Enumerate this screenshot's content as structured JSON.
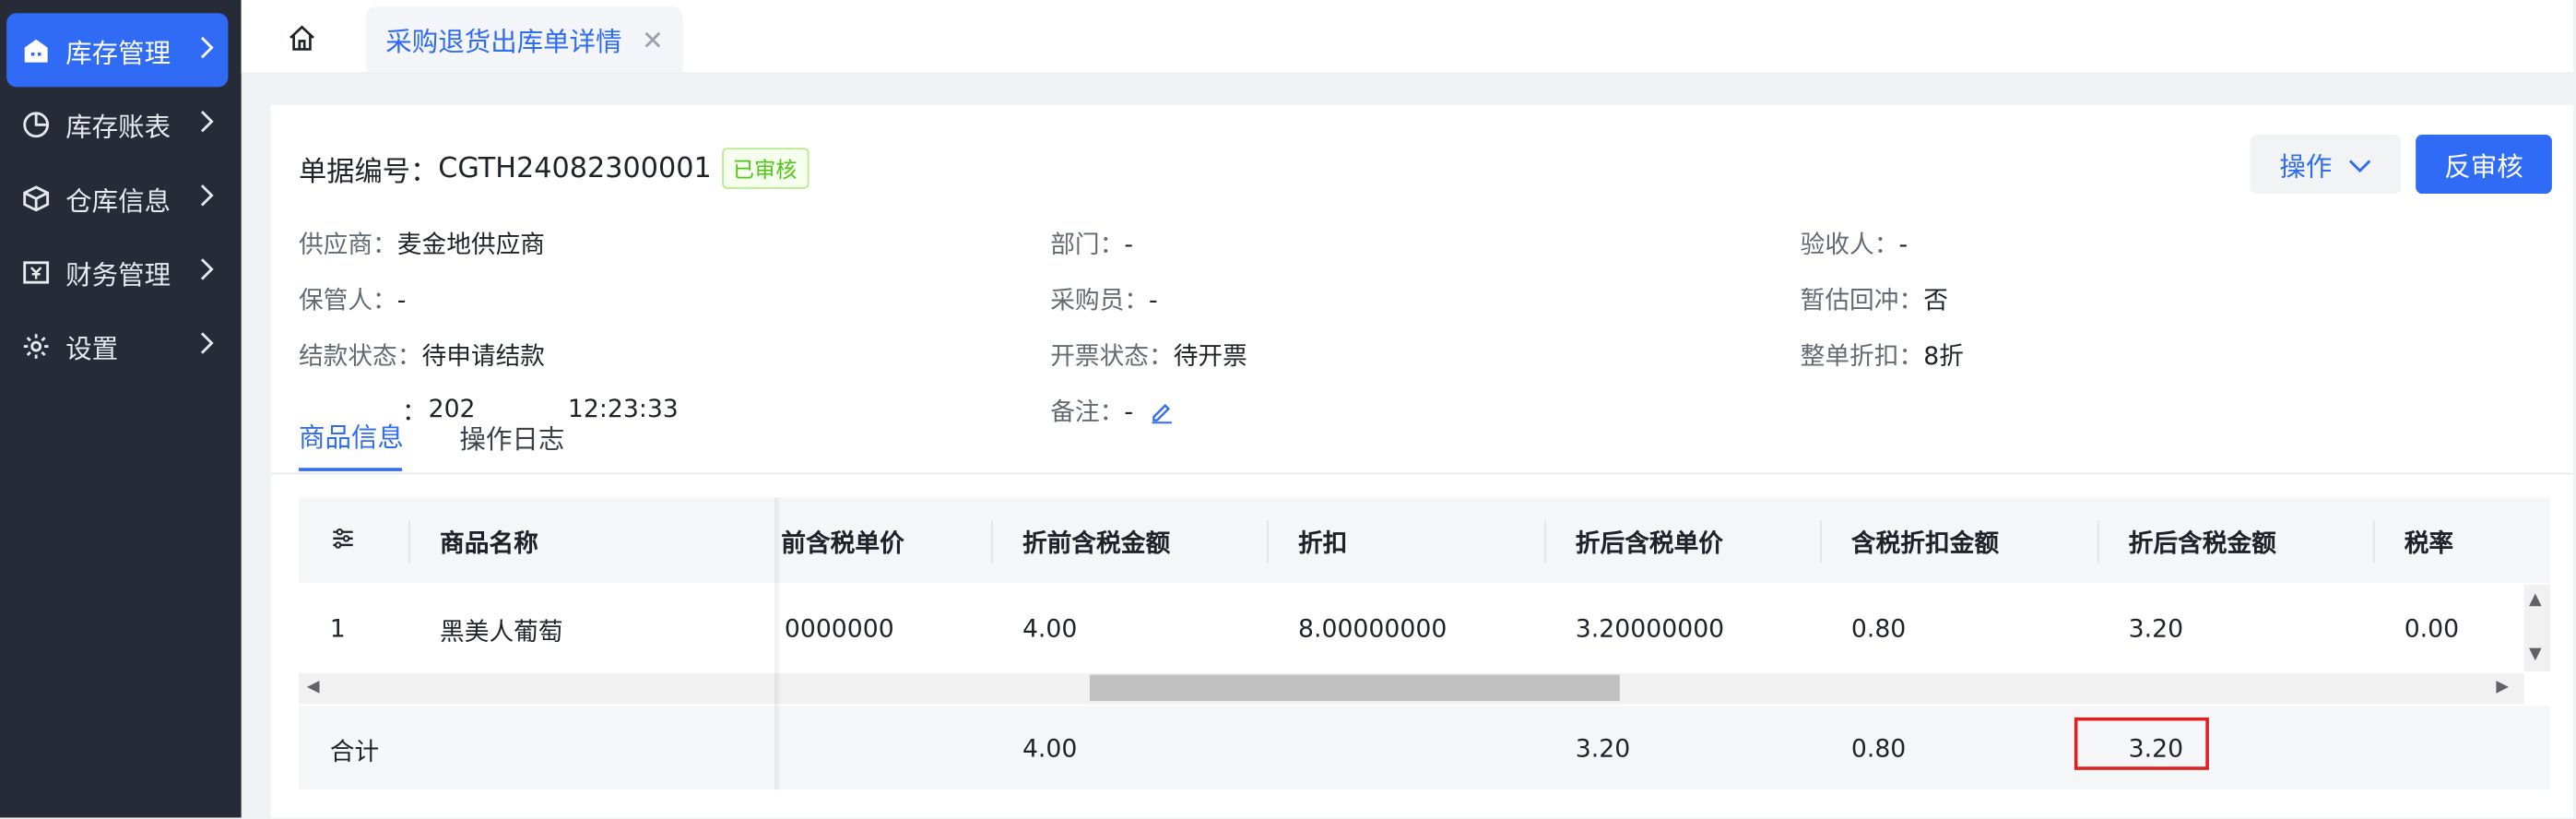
{
  "sidebar": {
    "items": [
      {
        "label": "库存管理",
        "icon": "warehouse-icon",
        "active": true
      },
      {
        "label": "库存账表",
        "icon": "pie-chart-icon",
        "active": false
      },
      {
        "label": "仓库信息",
        "icon": "box-icon",
        "active": false
      },
      {
        "label": "财务管理",
        "icon": "finance-icon",
        "active": false
      },
      {
        "label": "设置",
        "icon": "gear-icon",
        "active": false
      }
    ]
  },
  "tabs": {
    "home_icon": "home-icon",
    "active_tab": "采购退货出库单详情",
    "close_glyph": "✕"
  },
  "doc": {
    "number_label": "单据编号：",
    "number": "CGTH24082300001",
    "status": "已审核",
    "op_button": "操作",
    "reverse_button": "反审核"
  },
  "fields": {
    "supplier": {
      "k": "供应商：",
      "v": "麦金地供应商"
    },
    "dept": {
      "k": "部门：",
      "v": "-"
    },
    "inspector": {
      "k": "验收人：",
      "v": "-"
    },
    "keeper": {
      "k": "保管人：",
      "v": "-"
    },
    "buyer": {
      "k": "采购员：",
      "v": "-"
    },
    "offset": {
      "k": "暂估回冲：",
      "v": "否"
    },
    "settle": {
      "k": "结款状态：",
      "v": "待申请结款"
    },
    "invoice": {
      "k": "开票状态：",
      "v": "待开票"
    },
    "discount": {
      "k": "整单折扣：",
      "v": "8折"
    },
    "time_partial_a": "：",
    "time_partial_b": "202",
    "time_partial_c": "12:23:33",
    "remark": {
      "k": "备注：",
      "v": "-"
    }
  },
  "detail_tabs": [
    "商品信息",
    "操作日志"
  ],
  "table": {
    "headers": [
      "商品名称",
      "前含税单价",
      "折前含税金额",
      "折扣",
      "折后含税单价",
      "含税折扣金额",
      "折后含税金额",
      "税率"
    ],
    "row": {
      "index": "1",
      "name": "黑美人葡萄",
      "unit_price": "0000000",
      "pre_amount": "4.00",
      "discount": "8.00000000",
      "post_unit_price": "3.20000000",
      "discount_amount": "0.80",
      "post_amount": "3.20",
      "tax_rate": "0.00"
    },
    "summary": {
      "label": "合计",
      "pre_amount": "4.00",
      "post_unit_price": "3.20",
      "discount_amount": "0.80",
      "post_amount": "3.20"
    }
  },
  "colors": {
    "accent": "#2f6bf4",
    "sidebar_bg": "#262b37",
    "highlight": "#e02020"
  }
}
